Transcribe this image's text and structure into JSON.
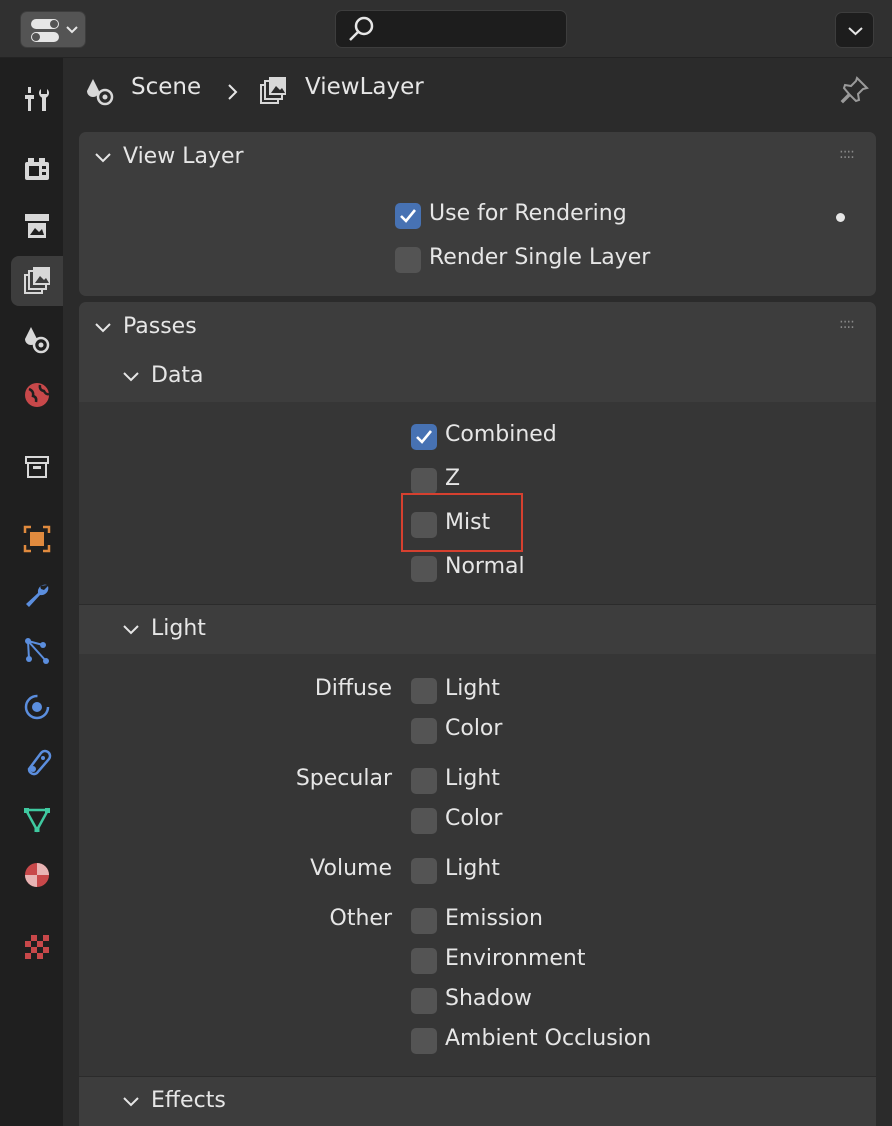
{
  "header": {
    "search_placeholder": ""
  },
  "breadcrumb": {
    "scene": "Scene",
    "separator": ">",
    "view_layer": "ViewLayer"
  },
  "view_layer_panel": {
    "title": "View Layer",
    "use_for_rendering": {
      "label": "Use for Rendering",
      "checked": true
    },
    "render_single_layer": {
      "label": "Render Single Layer",
      "checked": false
    }
  },
  "passes_panel": {
    "title": "Passes",
    "data": {
      "title": "Data",
      "combined": {
        "label": "Combined",
        "checked": true
      },
      "z": {
        "label": "Z",
        "checked": false
      },
      "mist": {
        "label": "Mist",
        "checked": false
      },
      "normal": {
        "label": "Normal",
        "checked": false
      }
    },
    "light": {
      "title": "Light",
      "diffuse": {
        "row_label": "Diffuse",
        "light": "Light",
        "color": "Color"
      },
      "specular": {
        "row_label": "Specular",
        "light": "Light",
        "color": "Color"
      },
      "volume": {
        "row_label": "Volume",
        "light": "Light"
      },
      "other": {
        "row_label": "Other",
        "emission": "Emission",
        "environment": "Environment",
        "shadow": "Shadow",
        "ambient_occlusion": "Ambient Occlusion"
      }
    },
    "effects": {
      "title": "Effects"
    }
  },
  "colors": {
    "accent": "#4772b3",
    "highlight": "#d6402f"
  }
}
